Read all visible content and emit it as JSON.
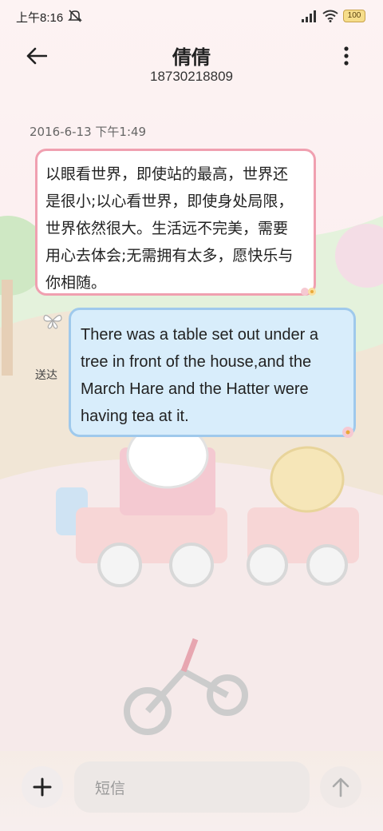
{
  "status_bar": {
    "time": "上午8:16",
    "battery_label": "100"
  },
  "header": {
    "contact_name": "倩倩",
    "contact_number": "18730218809"
  },
  "conversation": {
    "timestamp": "2016-6-13 下午1:49",
    "messages": [
      {
        "direction": "incoming",
        "lines": [
          "以眼看世界，即使站的最高，世界还",
          "是很小;以心看世界，即使身处局限，",
          "世界依然很大。生活远不完美，需要",
          "用心去体会;无需拥有太多，愿快乐与",
          "你相随。"
        ]
      },
      {
        "direction": "outgoing",
        "lines": [
          "There was a table set out under a",
          "tree in front of the house,and the",
          "March Hare and the Hatter were",
          "having tea at it."
        ],
        "status": "送达"
      }
    ]
  },
  "composer": {
    "placeholder": "短信"
  },
  "colors": {
    "incoming_border": "#f0a0b0",
    "outgoing_bubble": "#d8edfb",
    "outgoing_border": "#9fc9ec"
  },
  "icons": [
    "mute-icon",
    "signal-icon",
    "wifi-icon",
    "battery-icon",
    "back-arrow-icon",
    "more-vertical-icon",
    "plus-icon",
    "send-arrow-icon"
  ]
}
